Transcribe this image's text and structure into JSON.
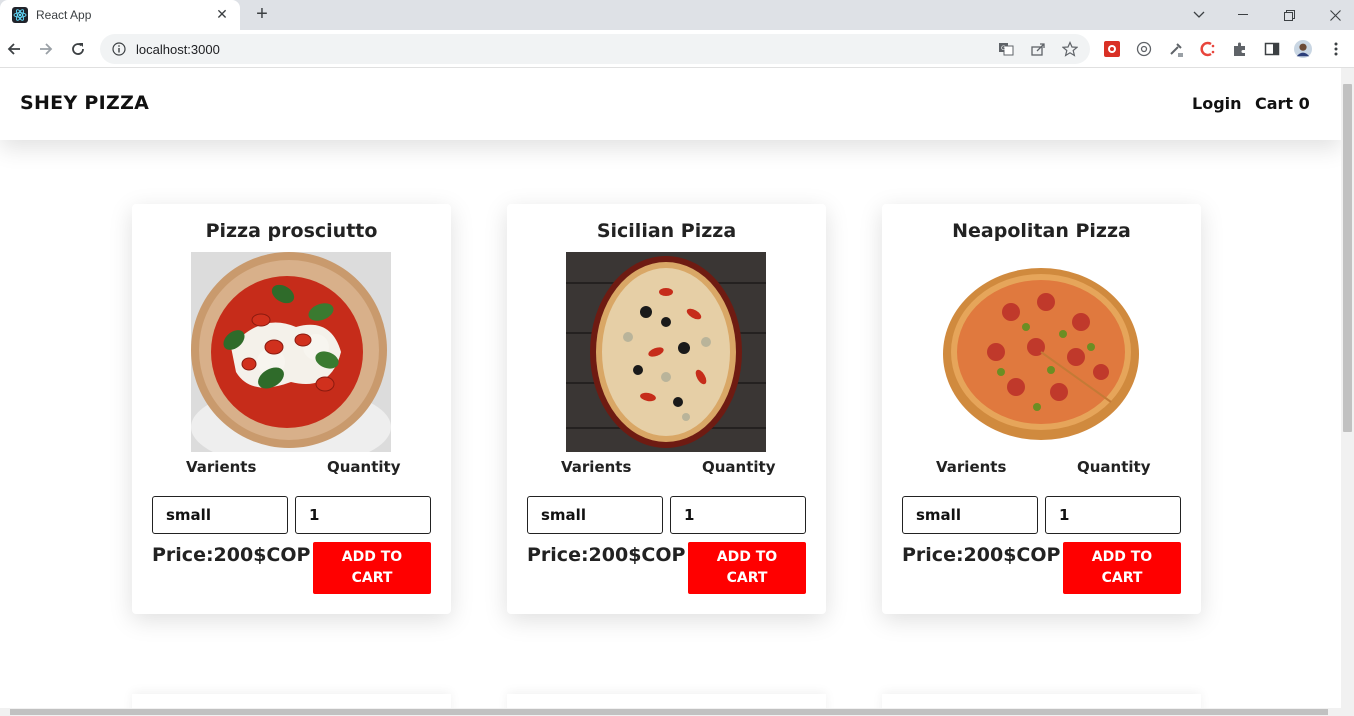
{
  "browser": {
    "tab_title": "React App",
    "tab_close": "✕",
    "new_tab": "+",
    "url": "localhost:3000"
  },
  "site": {
    "brand": "SHEY PIZZA",
    "nav": {
      "login": "Login",
      "cart": "Cart 0"
    }
  },
  "labels": {
    "variants": "Varients",
    "quantity": "Quantity",
    "add_to_cart": "ADD TO CART"
  },
  "products": [
    {
      "name": "Pizza prosciutto",
      "variant": "small",
      "quantity": "1",
      "price": "Price:200$COP"
    },
    {
      "name": "Sicilian Pizza",
      "variant": "small",
      "quantity": "1",
      "price": "Price:200$COP"
    },
    {
      "name": "Neapolitan Pizza",
      "variant": "small",
      "quantity": "1",
      "price": "Price:200$COP"
    }
  ],
  "colors": {
    "accent": "#ff0000",
    "text": "#222222"
  }
}
